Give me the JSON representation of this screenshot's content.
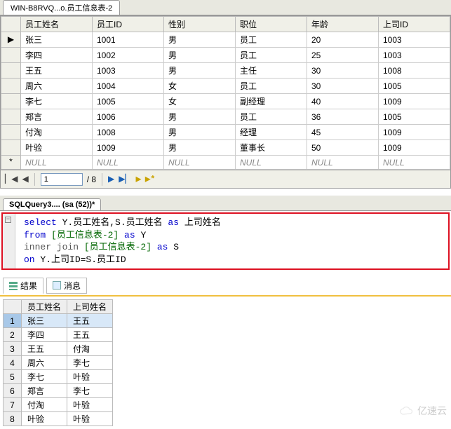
{
  "top_tab": {
    "title": "WIN-B8RVQ...o.员工信息表-2"
  },
  "grid": {
    "columns": [
      "员工姓名",
      "员工ID",
      "性别",
      "职位",
      "年龄",
      "上司ID"
    ],
    "rows": [
      {
        "hdr": "▶",
        "c": [
          "张三",
          "1001",
          "男",
          "员工",
          "20",
          "1003"
        ]
      },
      {
        "hdr": "",
        "c": [
          "李四",
          "1002",
          "男",
          "员工",
          "25",
          "1003"
        ]
      },
      {
        "hdr": "",
        "c": [
          "王五",
          "1003",
          "男",
          "主任",
          "30",
          "1008"
        ]
      },
      {
        "hdr": "",
        "c": [
          "周六",
          "1004",
          "女",
          "员工",
          "30",
          "1005"
        ]
      },
      {
        "hdr": "",
        "c": [
          "李七",
          "1005",
          "女",
          "副经理",
          "40",
          "1009"
        ]
      },
      {
        "hdr": "",
        "c": [
          "郑言",
          "1006",
          "男",
          "员工",
          "36",
          "1005"
        ]
      },
      {
        "hdr": "",
        "c": [
          "付淘",
          "1008",
          "男",
          "经理",
          "45",
          "1009"
        ]
      },
      {
        "hdr": "",
        "c": [
          "叶验",
          "1009",
          "男",
          "董事长",
          "50",
          "1009"
        ]
      },
      {
        "hdr": "*",
        "c": [
          "NULL",
          "NULL",
          "NULL",
          "NULL",
          "NULL",
          "NULL"
        ]
      }
    ]
  },
  "nav": {
    "first": "▏◀",
    "prev": "◀",
    "pos": "1",
    "total": "/ 8",
    "next": "▶",
    "last": "▶▏",
    "play": "▶",
    "stop": "▶*",
    "goend": "▶*"
  },
  "sql_tab": {
    "title": "SQLQuery3.... (sa (52))*"
  },
  "sql": {
    "l1a": "select",
    "l1b": " Y.员工姓名,S.员工姓名 ",
    "l1c": "as",
    "l1d": " 上司姓名",
    "l2a": "from",
    "l2b": " [员工信息表-2] ",
    "l2c": "as",
    "l2d": " Y",
    "l3a": "inner join",
    "l3b": " [员工信息表-2] ",
    "l3c": "as",
    "l3d": " S",
    "l4a": "on",
    "l4b": " Y.上司ID=S.员工ID"
  },
  "result_tabs": {
    "results": "结果",
    "messages": "消息"
  },
  "result": {
    "columns": [
      "员工姓名",
      "上司姓名"
    ],
    "rows": [
      [
        "张三",
        "王五"
      ],
      [
        "李四",
        "王五"
      ],
      [
        "王五",
        "付淘"
      ],
      [
        "周六",
        "李七"
      ],
      [
        "李七",
        "叶验"
      ],
      [
        "郑言",
        "李七"
      ],
      [
        "付淘",
        "叶验"
      ],
      [
        "叶验",
        "叶验"
      ]
    ]
  },
  "watermark": "亿速云"
}
